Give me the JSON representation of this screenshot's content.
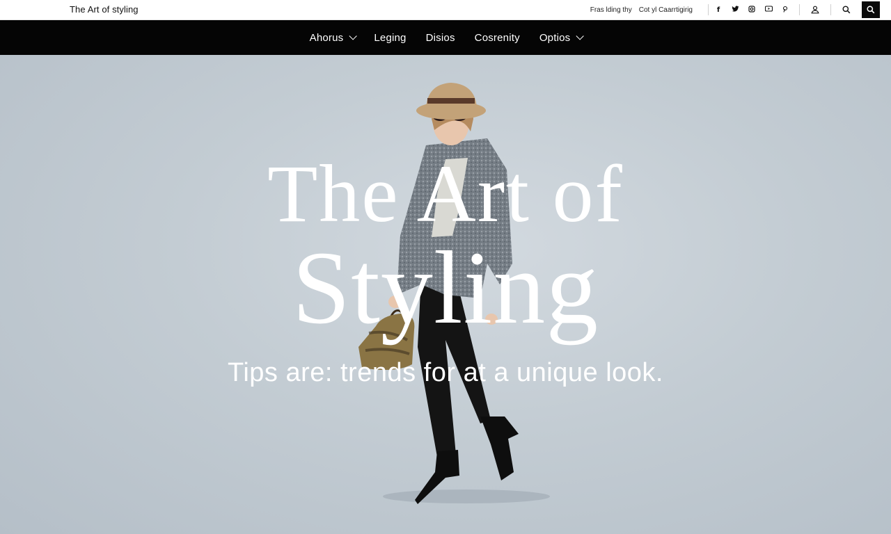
{
  "site": {
    "brand": "The Art of styling"
  },
  "utility": {
    "links": [
      "Fras lding thy",
      "Cot yl Caarrtigirig"
    ],
    "social_icons": [
      "facebook-icon",
      "twitter-icon",
      "instagram-icon",
      "youtube-icon",
      "pinterest-icon"
    ],
    "social_glyphs": [
      "f",
      "𝕥",
      "◎",
      "▭",
      "℗"
    ]
  },
  "nav": {
    "items": [
      {
        "label": "Ahorus",
        "has_dropdown": true
      },
      {
        "label": "Leging",
        "has_dropdown": false
      },
      {
        "label": "Disios",
        "has_dropdown": false
      },
      {
        "label": "Cosrenity",
        "has_dropdown": false
      },
      {
        "label": "Optios",
        "has_dropdown": true
      }
    ]
  },
  "hero": {
    "title_line1": "The Art of",
    "title_line2": "Styling",
    "tagline": "Tips are: trends for at a unique look."
  },
  "colors": {
    "nav_bg": "#050505",
    "hero_bg": "#c3ccd3",
    "hero_text": "#ffffff",
    "search_bg": "#0a0a0a"
  }
}
